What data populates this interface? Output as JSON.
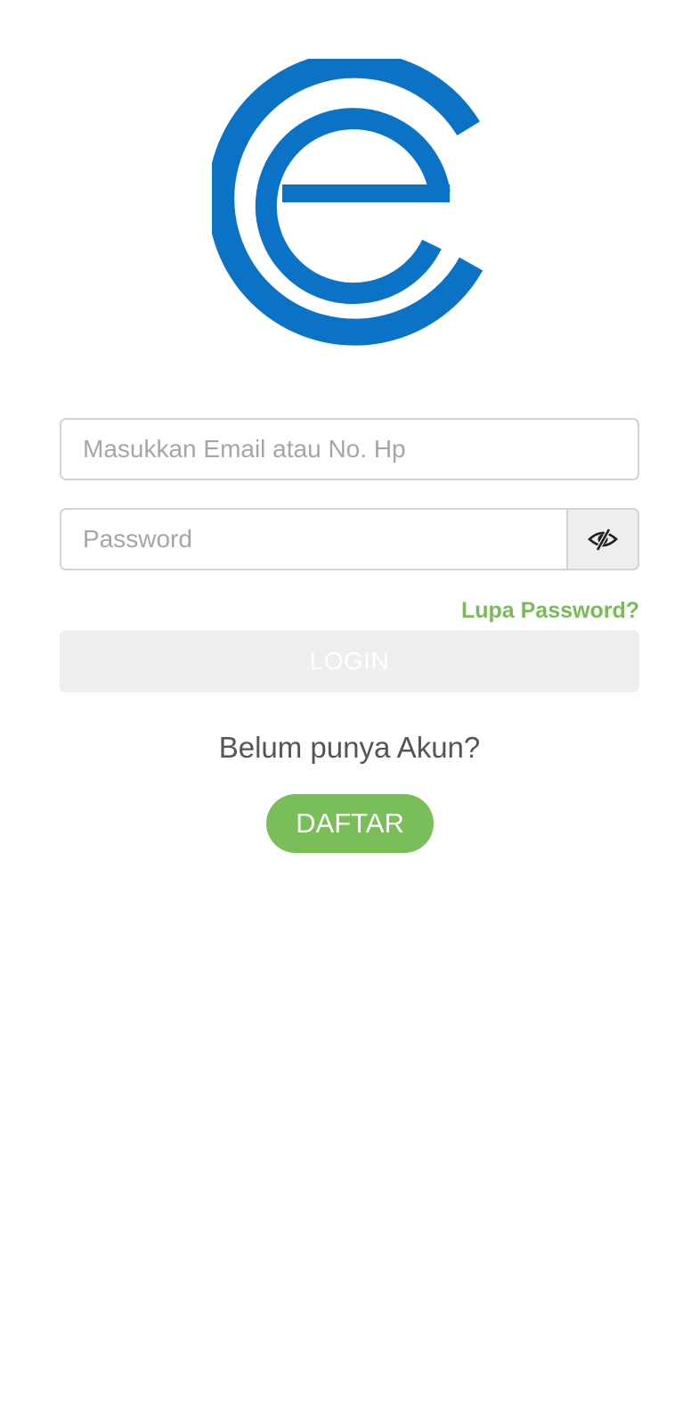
{
  "logo": {
    "icon": "brand-e-logo-icon",
    "color": "#0a73c6"
  },
  "login_form": {
    "email_placeholder": "Masukkan Email atau No. Hp",
    "email_value": "",
    "password_placeholder": "Password",
    "password_value": "",
    "toggle_icon": "eye-slash-icon",
    "forgot_password_label": "Lupa Password?",
    "login_button_label": "LOGIN"
  },
  "signup": {
    "prompt": "Belum punya Akun?",
    "register_button_label": "DAFTAR"
  },
  "colors": {
    "accent_green": "#7abe59",
    "brand_blue": "#0a73c6",
    "input_border": "#d3d3d3",
    "disabled_button_bg": "#eeeeee"
  }
}
